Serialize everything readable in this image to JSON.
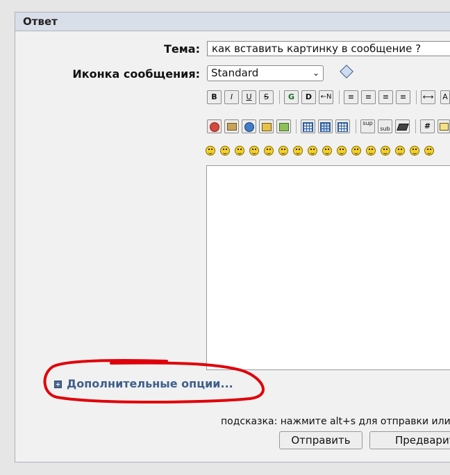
{
  "panel": {
    "title": "Ответ"
  },
  "form": {
    "subject_label": "Тема:",
    "subject_value": "как вставить картинку в сообщение ?",
    "icon_label": "Иконка сообщения:",
    "icon_selected": "Standard"
  },
  "toolbar": {
    "row1": [
      "B",
      "I",
      "U",
      "S",
      "G",
      "D",
      "←N",
      "≡",
      "≡",
      "≡",
      "≡",
      "⟷",
      "A"
    ],
    "row2": [
      "img1",
      "img2",
      "img3",
      "img4",
      "img5",
      "tbl1",
      "tbl2",
      "tbl3",
      "sup",
      "sub",
      "img6",
      "#",
      "img7"
    ],
    "smileys_count": 16
  },
  "more_options": {
    "label": "Дополнительные опции..."
  },
  "footer": {
    "hint": "подсказка: нажмите alt+s для отправки или",
    "submit_label": "Отправить",
    "preview_label": "Предварительный просмотр"
  },
  "colors": {
    "link": "#3f5f8a",
    "annotation": "#e0000a"
  }
}
